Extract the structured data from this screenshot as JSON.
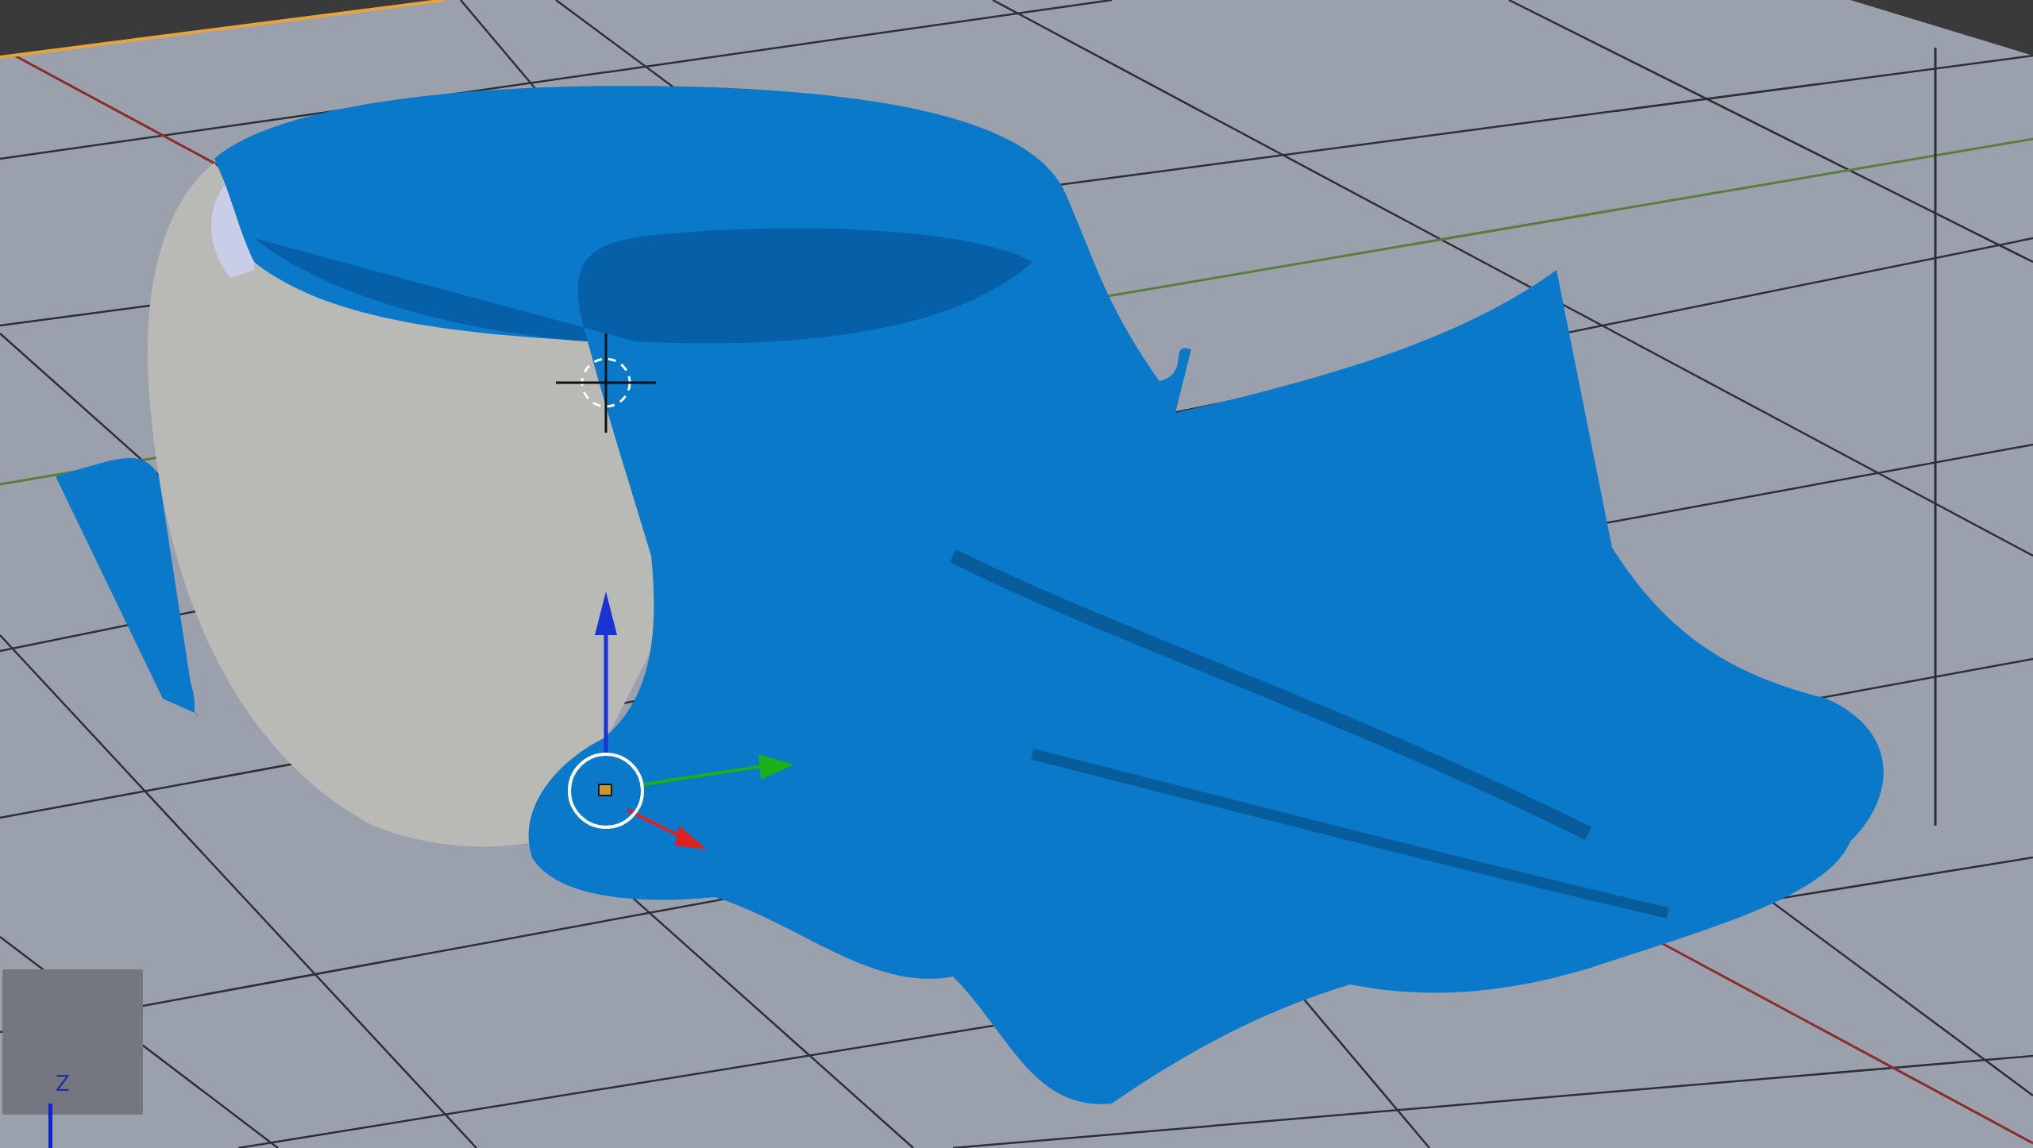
{
  "viewport": {
    "navigation_gizmo": {
      "axis_label": "Z"
    }
  }
}
